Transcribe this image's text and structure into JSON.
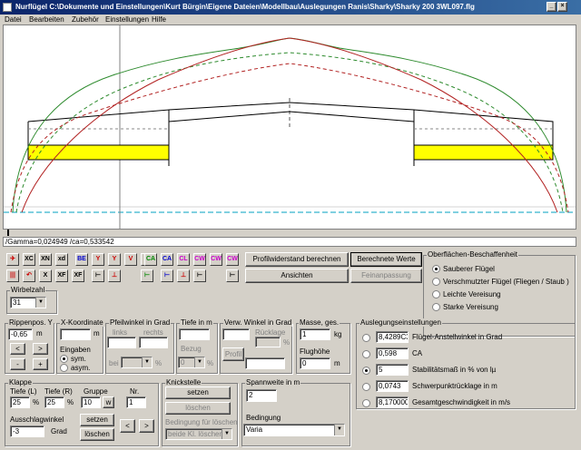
{
  "title": "Nurflügel  C:\\Dokumente und Einstellungen\\Kurt Bürgin\\Eigene Dateien\\Modellbau\\Auslegungen Ranis\\Sharky\\Sharky 200 3WL097.flg",
  "menu": [
    "Datei",
    "Bearbeiten",
    "Zubehör",
    "Einstellungen",
    "Hilfe"
  ],
  "status": "/Gamma=0,024949 /ca=0,533542",
  "toolbar": {
    "row1": [
      "XC",
      "XN",
      "xd",
      "BE",
      "Y",
      "Y",
      "V",
      "V",
      "CA",
      "CA",
      "CL",
      "CW",
      "CW",
      "CW"
    ],
    "row2": [
      "X",
      "XF",
      "XF"
    ]
  },
  "buttons": {
    "profilwiderstand": "Profilwiderstand berechnen",
    "berechnete_werte": "Berechnete Werte",
    "ansichten": "Ansichten",
    "feinanpassung": "Feinanpassung",
    "profil": "Profil",
    "setzen": "setzen",
    "loeschen": "löschen",
    "pfeil_li": "<",
    "pfeil_re": ">",
    "minus": "-",
    "plus": "+",
    "w": "w"
  },
  "oberflaeche": {
    "title": "Oberflächen-Beschaffenheit",
    "options": [
      "Sauberer Flügel",
      "Verschmutzter Flügel (Fliegen / Staub )",
      "Leichte Vereisung",
      "Starke Vereisung"
    ],
    "selected": 0
  },
  "wirbelzahl": {
    "label": "Wirbelzahl",
    "value": "31"
  },
  "rippenpos": {
    "label": "Rippenpos. Y",
    "value": "-0,65",
    "unit": "m"
  },
  "xkoord": {
    "label": "X-Koordinate",
    "unit": "m",
    "eingaben": "Eingaben",
    "sym": "sym.",
    "asym": "asym."
  },
  "pfeil": {
    "label": "Pfeilwinkel in Grad",
    "links": "links",
    "rechts": "rechts",
    "bei": "bei",
    "val": "%"
  },
  "tiefe": {
    "label": "Tiefe in m",
    "bezug": "Bezug",
    "val": "0",
    "pct": "%"
  },
  "verwind": {
    "label": "Verw. Winkel in Grad",
    "ruecklage": "Rücklage",
    "pct": "%"
  },
  "masse": {
    "label": "Masse, ges.",
    "value": "1",
    "unit": "kg"
  },
  "flughoehe": {
    "label": "Flughöhe",
    "value": "0",
    "unit": "m"
  },
  "klappe": {
    "title": "Klappe",
    "tiefe_l": "Tiefe (L)",
    "tiefe_r": "Tiefe (R)",
    "gruppe": "Gruppe",
    "nr": "Nr.",
    "tl": "25",
    "tr": "25",
    "pct": "%",
    "gruppe_val": "10",
    "nr_val": "1",
    "ausschlag": "Ausschlagwinkel",
    "aus_val": "-3",
    "grad": "Grad"
  },
  "knick": {
    "title": "Knickstelle",
    "setzen": "setzen",
    "loeschen": "löschen",
    "bedingung": "Bedingung für löschen",
    "select": "beide Kl. löschen"
  },
  "spann": {
    "label": "Spannweite in m",
    "value": "2",
    "bed": "Bedingung",
    "select": "Varia"
  },
  "auslegung": {
    "title": "Auslegungseinstellungen",
    "rows": [
      {
        "value": "8,4289C3",
        "label": "Flügel-Anstellwinkel in Grad"
      },
      {
        "value": "0,598",
        "label": "CA"
      },
      {
        "value": "5",
        "label": "Stabilitätsmaß in % von lµ"
      },
      {
        "value": "0,0743",
        "label": "Schwerpunktrücklage in m"
      },
      {
        "value": "8,170000",
        "label": "Gesamtgeschwindigkeit in m/s"
      }
    ],
    "selected": 2
  },
  "colors": {
    "green": "#2e8b2e",
    "red": "#b22222",
    "wing_fill": "#ffff00",
    "cyan": "#00a0c0"
  }
}
